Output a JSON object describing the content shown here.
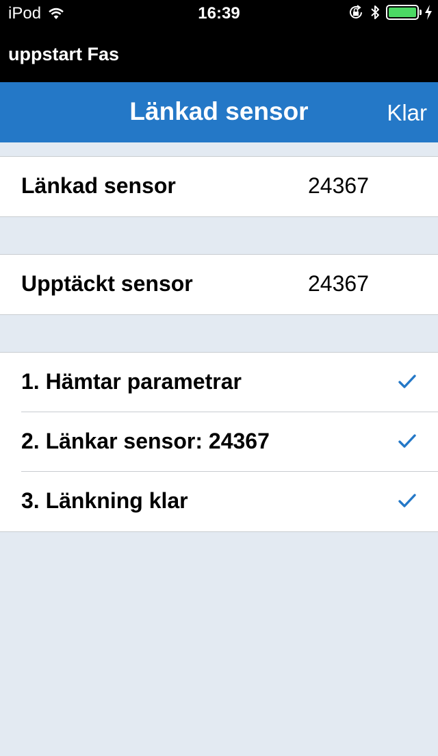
{
  "status_bar": {
    "carrier": "iPod",
    "time": "16:39",
    "icons": [
      "wifi-icon",
      "rotation-lock-icon",
      "bluetooth-icon",
      "battery-icon",
      "charging-icon"
    ]
  },
  "app": {
    "title": "uppstart Fas"
  },
  "navbar": {
    "title": "Länkad sensor",
    "done_label": "Klar",
    "color": "#2478c7"
  },
  "linked": {
    "label": "Länkad sensor",
    "value": "24367"
  },
  "detected": {
    "label": "Upptäckt sensor",
    "value": "24367"
  },
  "steps": [
    {
      "label": "1. Hämtar parametrar",
      "done": true
    },
    {
      "label": "2. Länkar sensor: 24367",
      "done": true
    },
    {
      "label": "3. Länkning klar",
      "done": true
    }
  ],
  "colors": {
    "check": "#2478c7",
    "background": "#e3eaf2"
  }
}
